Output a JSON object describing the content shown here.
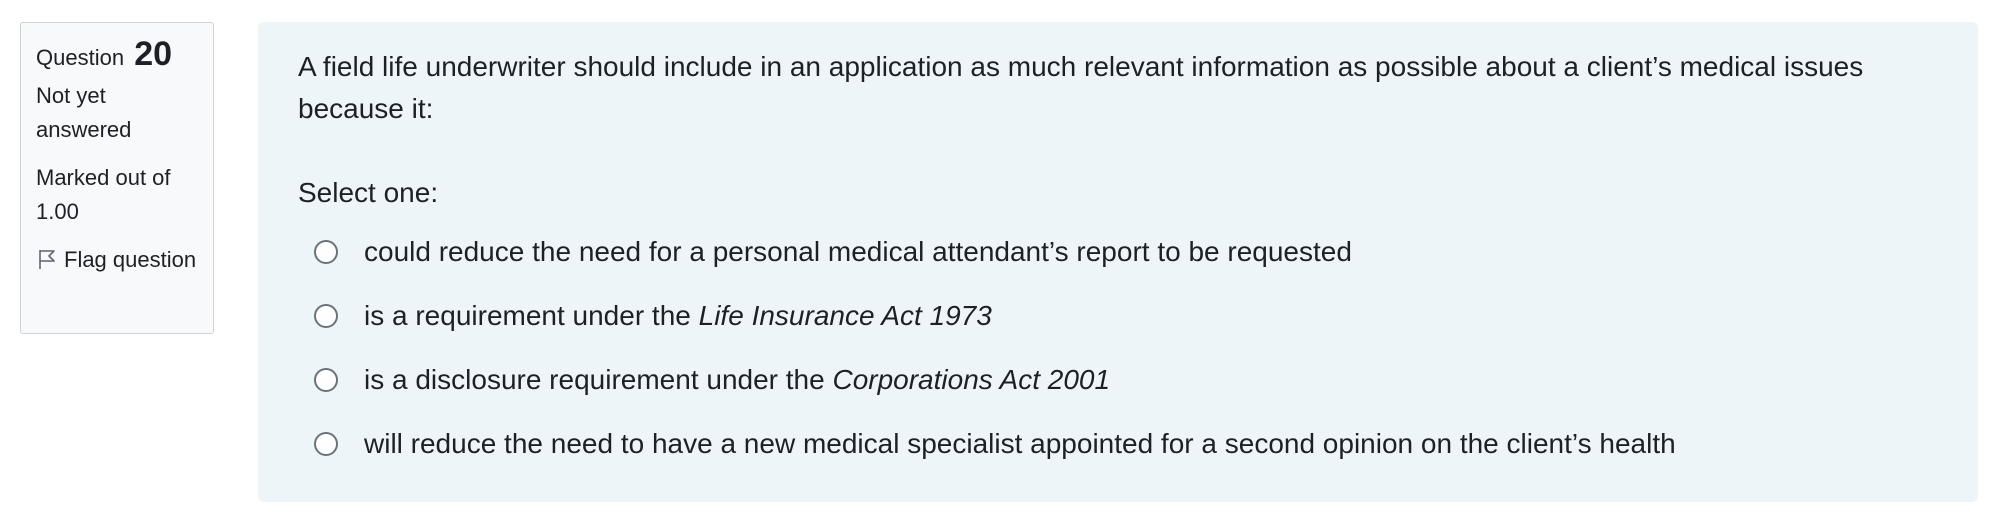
{
  "info": {
    "question_label": "Question",
    "question_number": "20",
    "state": "Not yet answered",
    "grade": "Marked out of 1.00",
    "flag_label": "Flag question"
  },
  "question": {
    "text": "A field life underwriter should include in an application as much relevant information as possible about a client’s medical issues because it:",
    "prompt": "Select one:",
    "answers": [
      {
        "plain": "could reduce the need for a personal medical attendant’s report to be requested",
        "italic": ""
      },
      {
        "plain": "is a requirement under the ",
        "italic": "Life Insurance Act 1973"
      },
      {
        "plain": "is a disclosure requirement under the ",
        "italic": "Corporations Act 2001"
      },
      {
        "plain": "will reduce the need to have a new medical specialist appointed for a second opinion on the client’s health",
        "italic": ""
      }
    ]
  },
  "icons": {
    "flag": "flag-icon",
    "radio": "radio-button"
  },
  "colors": {
    "content_background": "#eef5f8",
    "info_background": "#f8f9fa",
    "info_border": "#cfd3d7",
    "text": "#1d2125"
  }
}
